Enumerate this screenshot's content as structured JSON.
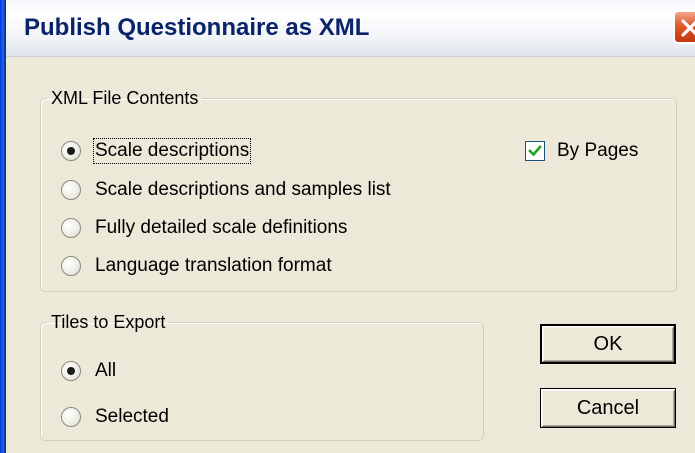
{
  "window": {
    "title": "Publish Questionnaire as XML",
    "close_icon": "close-icon"
  },
  "xml_file_contents": {
    "legend": "XML File Contents",
    "options": [
      {
        "label": "Scale descriptions",
        "checked": true
      },
      {
        "label": "Scale descriptions and samples list",
        "checked": false
      },
      {
        "label": "Fully detailed scale definitions",
        "checked": false
      },
      {
        "label": "Language translation format",
        "checked": false
      }
    ],
    "by_pages": {
      "label": "By Pages",
      "checked": true
    }
  },
  "tiles_to_export": {
    "legend": "Tiles to Export",
    "options": [
      {
        "label": "All",
        "checked": true
      },
      {
        "label": "Selected",
        "checked": false
      }
    ]
  },
  "buttons": {
    "ok": "OK",
    "cancel": "Cancel"
  },
  "colors": {
    "dialog_background": "#ece9d8",
    "title_text": "#0a246a",
    "close_button": "#e05a2c"
  }
}
